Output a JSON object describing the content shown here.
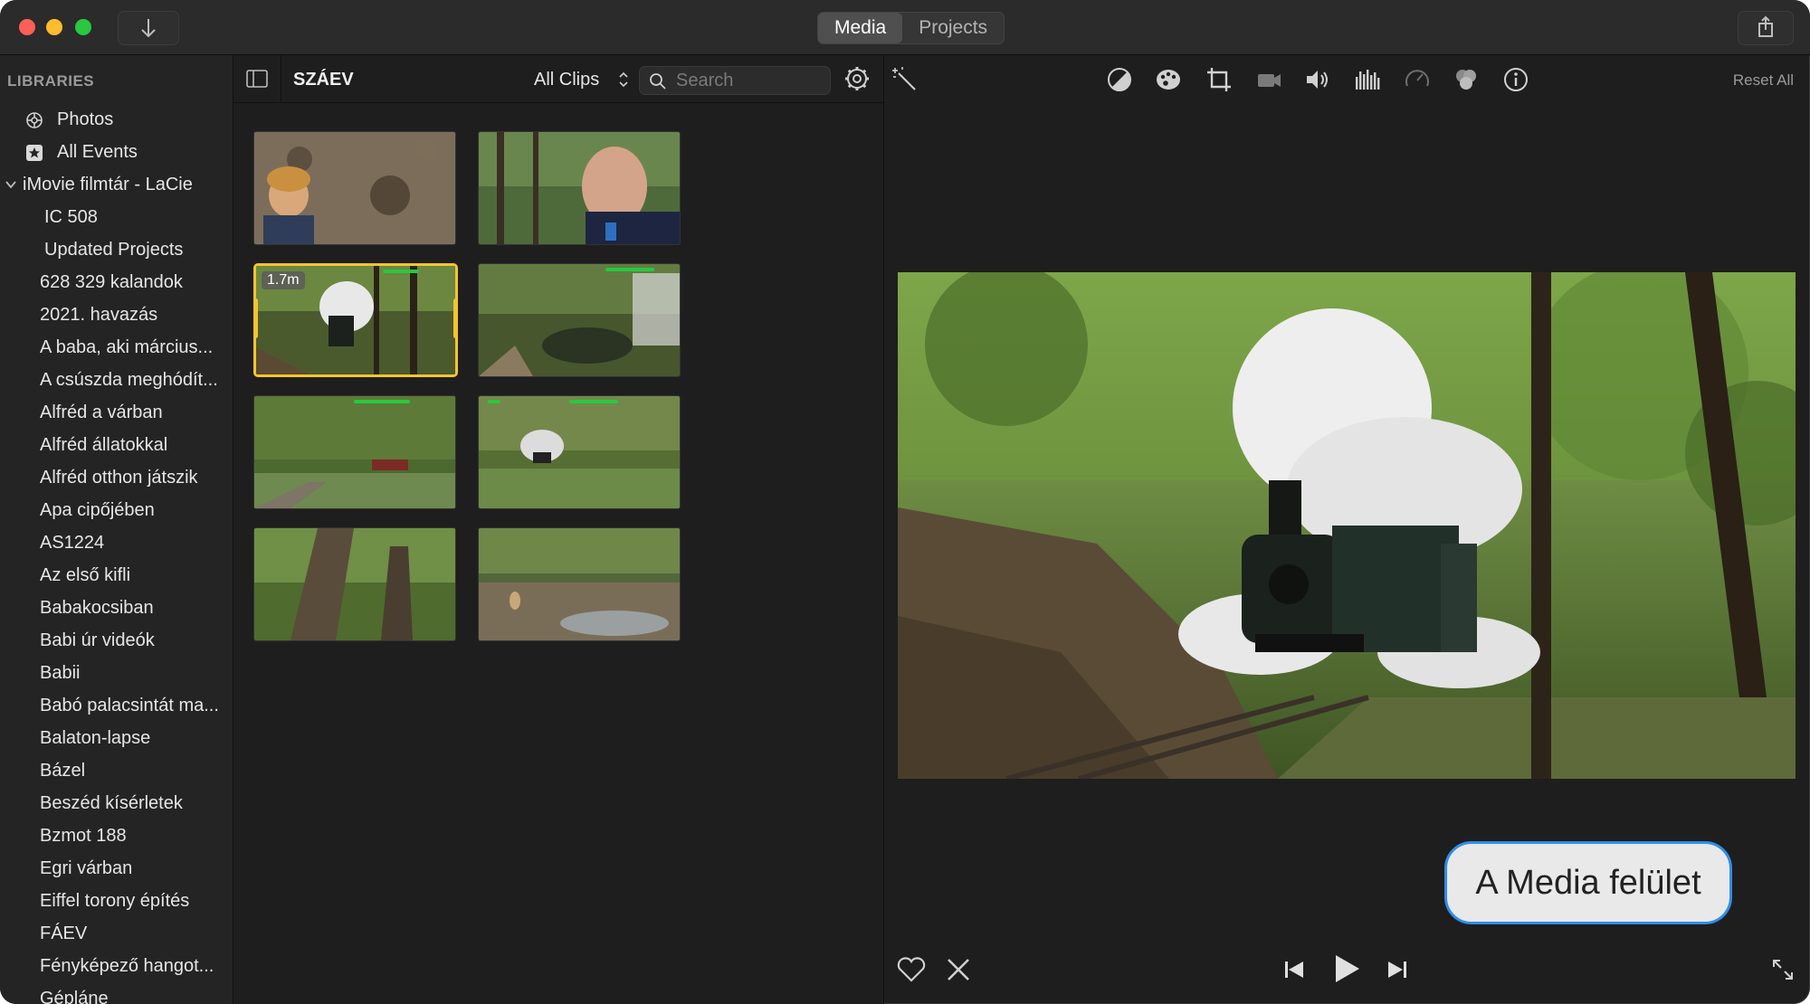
{
  "titlebar": {
    "tabs": [
      {
        "label": "Media",
        "active": true
      },
      {
        "label": "Projects",
        "active": false
      }
    ]
  },
  "sidebar": {
    "heading": "LIBRARIES",
    "top_items": [
      {
        "label": "Photos",
        "icon": "photos-icon"
      },
      {
        "label": "All Events",
        "icon": "star-icon"
      }
    ],
    "library": {
      "label": "iMovie filmtár - LaCie",
      "expanded": true
    },
    "library_items": [
      "IC 508",
      "Updated Projects",
      "628 329 kalandok",
      "2021. havazás",
      "A baba, aki március...",
      "A csúszda meghódít...",
      "Alfréd a várban",
      "Alfréd állatokkal",
      "Alfréd otthon játszik",
      "Apa cipőjében",
      "AS1224",
      "Az első kifli",
      "Babakocsiban",
      "Babi úr videók",
      "Babii",
      "Babó palacsintát ma...",
      "Balaton-lapse",
      "Bázel",
      "Beszéd kísérletek",
      "Bzmot 188",
      "Egri várban",
      "Eiffel torony építés",
      "FÁEV",
      "Fényképező hangot...",
      "Gépláne"
    ]
  },
  "browser": {
    "event_title": "SZÁEV",
    "clip_filter": "All Clips",
    "search_placeholder": "Search",
    "clips": [
      {
        "name": "clip-boy-leaves",
        "duration": "",
        "selected": false
      },
      {
        "name": "clip-man-selfie",
        "duration": "",
        "selected": false
      },
      {
        "name": "clip-steam-train",
        "duration": "1.7m",
        "selected": true
      },
      {
        "name": "clip-forest-track",
        "duration": "",
        "selected": false
      },
      {
        "name": "clip-rail-meadow",
        "duration": "",
        "selected": false
      },
      {
        "name": "clip-train-distance",
        "duration": "",
        "selected": false
      },
      {
        "name": "clip-tree-trunk",
        "duration": "",
        "selected": false
      },
      {
        "name": "clip-dog-stream",
        "duration": "",
        "selected": false
      }
    ]
  },
  "viewer": {
    "reset_label": "Reset All",
    "tools": [
      "magic-wand-icon",
      "color-balance-icon",
      "color-palette-icon",
      "crop-icon",
      "stabilization-icon",
      "volume-icon",
      "equalizer-icon",
      "speed-icon",
      "filter-icon",
      "info-icon"
    ],
    "callout": "A Media felület"
  },
  "colors": {
    "selection": "#f4c42f",
    "callout_border": "#2f8eea",
    "green_marker": "#28c840"
  }
}
